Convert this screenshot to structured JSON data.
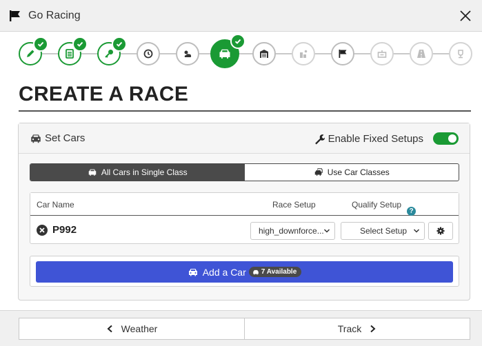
{
  "window": {
    "title": "Go Racing",
    "close_icon": "close-icon",
    "flag_icon": "flag-icon"
  },
  "stepper": {
    "accent_color": "#1a9a34",
    "steps": [
      {
        "icon": "pencil-icon",
        "state": "done"
      },
      {
        "icon": "list-icon",
        "state": "done"
      },
      {
        "icon": "key-icon",
        "state": "done"
      },
      {
        "icon": "clock-icon",
        "state": "pending"
      },
      {
        "icon": "weather-icon",
        "state": "pending"
      },
      {
        "icon": "car-icon",
        "state": "active"
      },
      {
        "icon": "garage-icon",
        "state": "pending"
      },
      {
        "icon": "pit-icon",
        "state": "future"
      },
      {
        "icon": "flag-icon",
        "state": "pending"
      },
      {
        "icon": "scoring-icon",
        "state": "future"
      },
      {
        "icon": "road-icon",
        "state": "future"
      },
      {
        "icon": "trophy-icon",
        "state": "future"
      }
    ]
  },
  "page": {
    "heading": "CREATE A RACE"
  },
  "cars_panel": {
    "title": "Set Cars",
    "fixed_setups_label": "Enable Fixed Setups",
    "fixed_setups_enabled": true,
    "mode_tabs": [
      {
        "label": "All Cars in Single Class",
        "selected": true
      },
      {
        "label": "Use Car Classes",
        "selected": false
      }
    ],
    "columns": {
      "car_name": "Car Name",
      "race_setup": "Race Setup",
      "qualify_setup": "Qualify Setup",
      "help_glyph": "?"
    },
    "rows": [
      {
        "car": "P992",
        "race_setup": "high_downforce...",
        "qualify_setup": "Select Setup"
      }
    ],
    "add_button": {
      "label": "Add a Car",
      "available": "7 Available",
      "color": "#3f54d6"
    }
  },
  "footer": {
    "back_label": "Weather",
    "next_label": "Track"
  }
}
